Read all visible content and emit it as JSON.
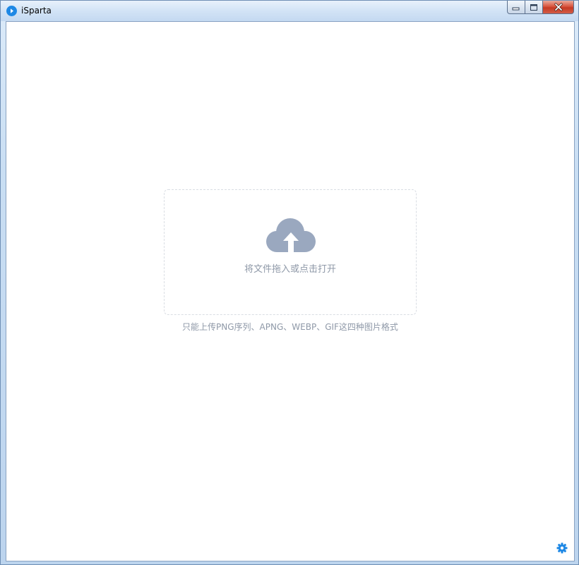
{
  "window": {
    "title": "iSparta"
  },
  "upload": {
    "drop_label": "将文件拖入或点击打开",
    "formats_hint": "只能上传PNG序列、APNG、WEBP、GIF这四种图片格式"
  },
  "icons": {
    "app": "isparta-logo-icon",
    "upload": "cloud-upload-icon",
    "settings": "gear-icon"
  },
  "colors": {
    "accent": "#1e88e5",
    "muted_text": "#8f99a8",
    "upload_icon": "#9aa8bf"
  }
}
